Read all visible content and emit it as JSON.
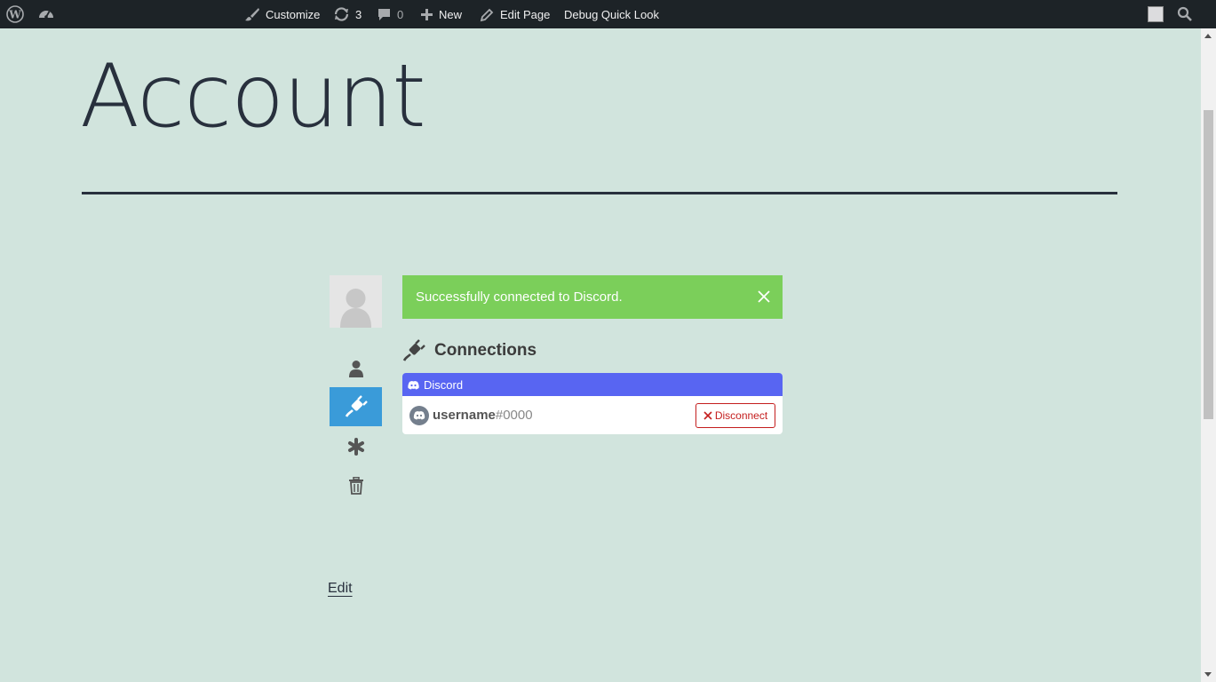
{
  "adminbar": {
    "customize_label": "Customize",
    "updates_count": "3",
    "comments_count": "0",
    "new_label": "New",
    "edit_page_label": "Edit Page",
    "debug_label": "Debug Quick Look"
  },
  "page": {
    "title": "Account",
    "edit_link": "Edit"
  },
  "alert": {
    "message": "Successfully connected to Discord.",
    "color": "#7bcf5a"
  },
  "connections": {
    "heading": "Connections",
    "provider": "Discord",
    "provider_color": "#5865f2",
    "username": "username",
    "discriminator": "#0000",
    "disconnect_label": "Disconnect"
  },
  "nav": {
    "items": [
      "user-icon",
      "plug-icon",
      "asterisk-icon",
      "trash-icon"
    ],
    "active_color": "#3a9bd9"
  },
  "colors": {
    "background": "#d1e4dd",
    "adminbar": "#1d2327",
    "disconnect": "#c41e1e"
  }
}
